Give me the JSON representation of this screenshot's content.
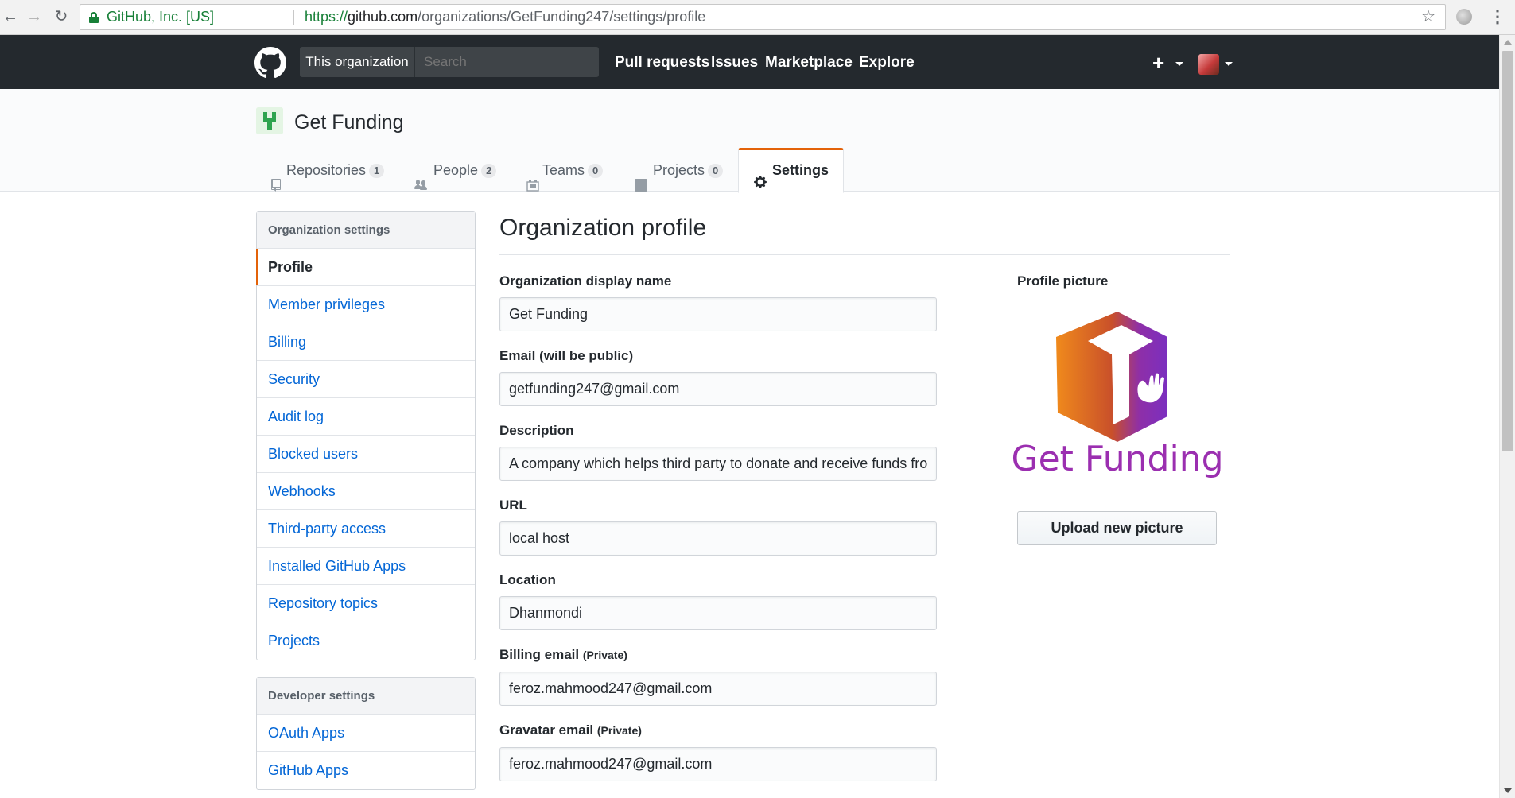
{
  "browser": {
    "secure_label": "GitHub, Inc. [US]",
    "url_scheme": "https://",
    "url_host": "github.com",
    "url_path": "/organizations/GetFunding247/settings/profile",
    "icons": [
      "back-icon",
      "forward-icon",
      "reload-icon",
      "lock-icon",
      "star-icon",
      "extension-icon",
      "menu-icon"
    ]
  },
  "header": {
    "scope_label": "This organization",
    "search_placeholder": "Search",
    "nav": [
      "Pull requests",
      "Issues",
      "Marketplace",
      "Explore"
    ],
    "plus_label": "+",
    "colors": {
      "background": "#24292e"
    }
  },
  "org": {
    "name": "Get Funding",
    "tabs": [
      {
        "label": "Repositories",
        "count": "1",
        "icon": "repo-icon"
      },
      {
        "label": "People",
        "count": "2",
        "icon": "people-icon"
      },
      {
        "label": "Teams",
        "count": "0",
        "icon": "teams-icon"
      },
      {
        "label": "Projects",
        "count": "0",
        "icon": "project-icon"
      },
      {
        "label": "Settings",
        "icon": "gear-icon",
        "active": true
      }
    ]
  },
  "sidebar": {
    "org_heading": "Organization settings",
    "org_items": [
      "Profile",
      "Member privileges",
      "Billing",
      "Security",
      "Audit log",
      "Blocked users",
      "Webhooks",
      "Third-party access",
      "Installed GitHub Apps",
      "Repository topics",
      "Projects"
    ],
    "dev_heading": "Developer settings",
    "dev_items": [
      "OAuth Apps",
      "GitHub Apps"
    ],
    "selected": "Profile",
    "accent": "#e36209"
  },
  "main": {
    "title": "Organization profile",
    "fields": {
      "display_name": {
        "label": "Organization display name",
        "value": "Get Funding"
      },
      "email": {
        "label": "Email (will be public)",
        "value": "getfunding247@gmail.com"
      },
      "description": {
        "label": "Description",
        "value": "A company which helps third party to donate and receive funds from"
      },
      "url": {
        "label": "URL",
        "value": "local host"
      },
      "location": {
        "label": "Location",
        "value": "Dhanmondi"
      },
      "billing_email": {
        "label": "Billing email",
        "note": "(Private)",
        "value": "feroz.mahmood247@gmail.com"
      },
      "gravatar_email": {
        "label": "Gravatar email",
        "note": "(Private)",
        "value": "feroz.mahmood247@gmail.com"
      }
    },
    "picture": {
      "label": "Profile picture",
      "logo_text": "Get Funding",
      "upload_label": "Upload new picture"
    }
  }
}
